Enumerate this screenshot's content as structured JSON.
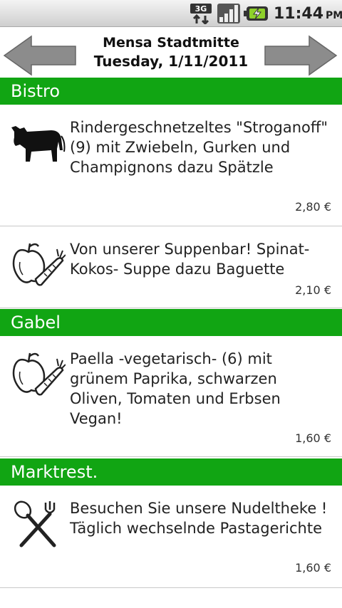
{
  "status_bar": {
    "network_icon": "3g-icon",
    "signal_icon": "signal-icon",
    "battery_icon": "battery-charging-icon",
    "time": "11:44",
    "ampm": "PM"
  },
  "header": {
    "location": "Mensa Stadtmitte",
    "date": "Tuesday, 1/11/2011",
    "prev_icon": "arrow-left-icon",
    "next_icon": "arrow-right-icon"
  },
  "sections": [
    {
      "name": "Bistro",
      "items": [
        {
          "icon": "cow-icon",
          "text": "Rindergeschnetzeltes \"Stroganoff\" (9) mit Zwiebeln, Gurken und Champignons dazu Spätzle",
          "price": "2,80 €"
        },
        {
          "icon": "apple-carrot-icon",
          "text": "Von unserer Suppenbar! Spinat-Kokos- Suppe dazu Baguette",
          "price": "2,10 €"
        }
      ]
    },
    {
      "name": "Gabel",
      "items": [
        {
          "icon": "apple-carrot-icon",
          "text": "Paella -vegetarisch- (6) mit grünem Paprika, schwarzen Oliven, Tomaten und Erbsen Vegan!",
          "price": "1,60 €"
        }
      ]
    },
    {
      "name": "Marktrest.",
      "items": [
        {
          "icon": "spoon-fork-icon",
          "text": "Besuchen Sie unsere Nudeltheke ! Täglich wechselnde Pastagerichte",
          "price": "1,60 €"
        }
      ]
    }
  ],
  "colors": {
    "section_header": "#11a513",
    "arrow": "#8c8c8c"
  }
}
